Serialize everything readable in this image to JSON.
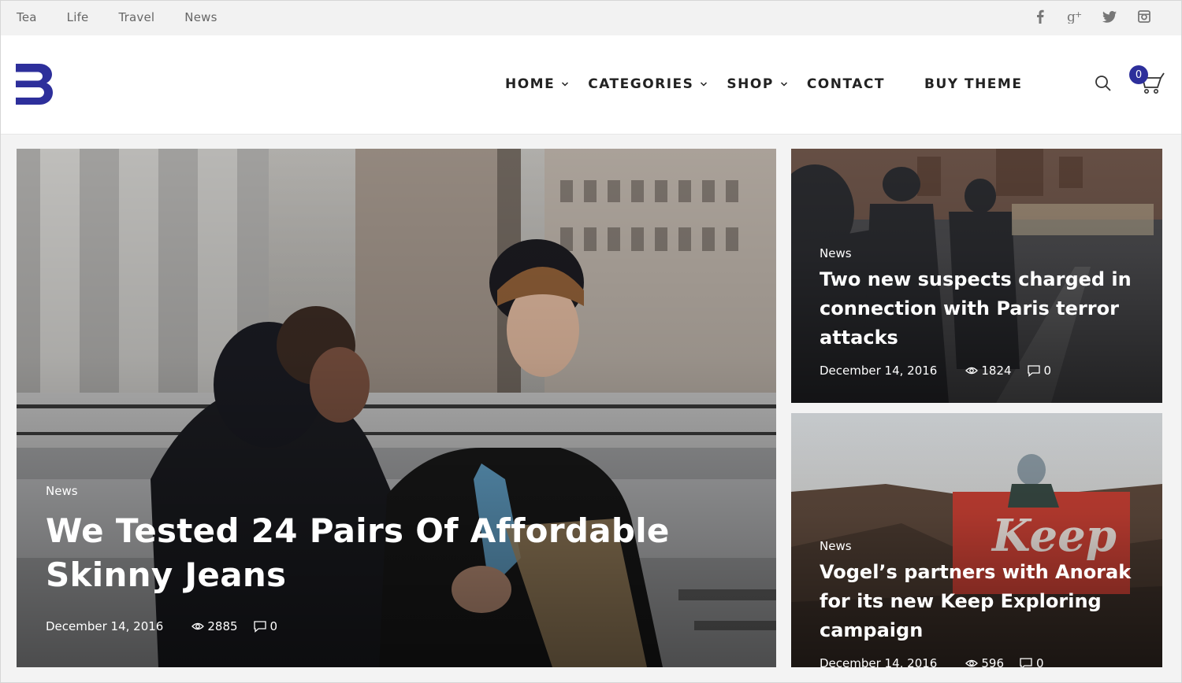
{
  "topbar": {
    "links": [
      "Tea",
      "Life",
      "Travel",
      "News"
    ],
    "social_icons": [
      "facebook-icon",
      "google-plus-icon",
      "twitter-icon",
      "instagram-icon"
    ]
  },
  "header": {
    "logo_letter": "B",
    "brand_color": "#2d2f9b",
    "nav": [
      {
        "label": "HOME",
        "has_dropdown": true
      },
      {
        "label": "CATEGORIES",
        "has_dropdown": true
      },
      {
        "label": "SHOP",
        "has_dropdown": true
      },
      {
        "label": "CONTACT",
        "has_dropdown": false
      },
      {
        "label": "BUY THEME",
        "has_dropdown": false
      }
    ],
    "cart_count": "0"
  },
  "featured": {
    "category": "News",
    "title": "We Tested 24 Pairs Of Affordable Skinny Jeans",
    "date": "December 14, 2016",
    "views": "2885",
    "comments": "0"
  },
  "side_posts": [
    {
      "category": "News",
      "title": "Two new suspects charged in connection with Paris terror attacks",
      "date": "December 14, 2016",
      "views": "1824",
      "comments": "0"
    },
    {
      "category": "News",
      "title": "Vogel’s partners with Anorak for its new Keep Exploring campaign",
      "date": "December 14, 2016",
      "views": "596",
      "comments": "0"
    }
  ]
}
